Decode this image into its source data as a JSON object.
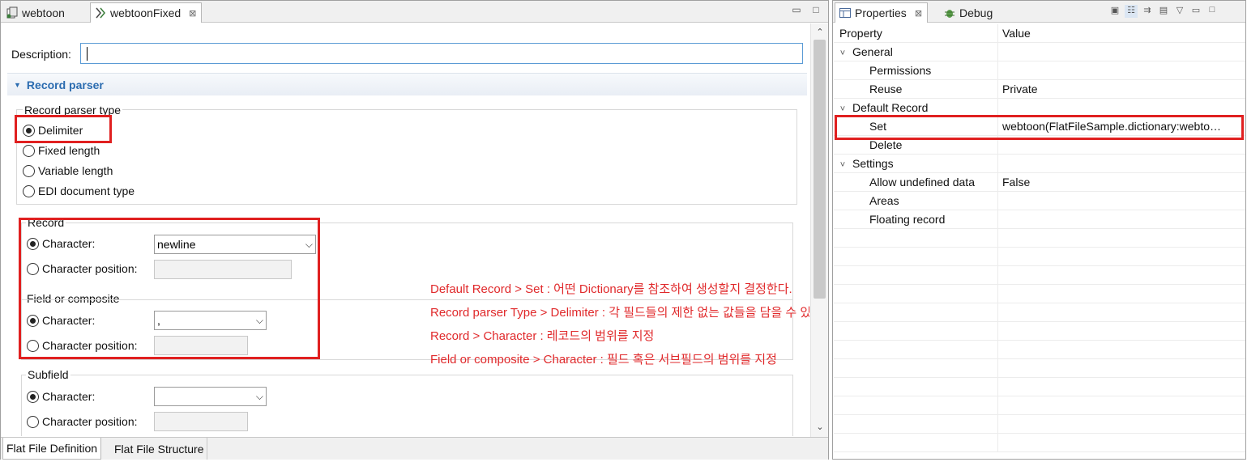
{
  "editor": {
    "tabs": [
      {
        "label": "webtoon"
      },
      {
        "label": "webtoonFixed"
      }
    ],
    "description_label": "Description:",
    "description_value": "",
    "section_title": "Record parser",
    "parser_type": {
      "title": "Record parser type",
      "options": [
        "Delimiter",
        "Fixed length",
        "Variable length",
        "EDI document type"
      ],
      "selected": "Delimiter"
    },
    "record": {
      "title": "Record",
      "character_label": "Character:",
      "character_value": "newline",
      "position_label": "Character position:"
    },
    "field": {
      "title": "Field or composite",
      "character_label": "Character:",
      "character_value": ",",
      "position_label": "Character position:"
    },
    "subfield": {
      "title": "Subfield",
      "character_label": "Character:",
      "character_value": "",
      "position_label": "Character position:"
    },
    "bottom_tabs": [
      "Flat File Definition",
      "Flat File Structure"
    ]
  },
  "notes": [
    "Default Record > Set : 어떤 Dictionary를 참조하여 생성할지 결정한다.",
    "Record parser Type > Delimiter : 각 필드들의 제한 없는 값들을 담을 수 있다.",
    "Record > Character : 레코드의 범위를 지정",
    "Field or composite > Character : 필드 혹은 서브필드의 범위를 지정"
  ],
  "properties": {
    "tabs": [
      "Properties",
      "Debug"
    ],
    "header": {
      "property": "Property",
      "value": "Value"
    },
    "rows": [
      {
        "name": "General",
        "value": "",
        "level": 0,
        "expander": "˅"
      },
      {
        "name": "Permissions",
        "value": "",
        "level": 1,
        "expander": ""
      },
      {
        "name": "Reuse",
        "value": "Private",
        "level": 1,
        "expander": ""
      },
      {
        "name": "Default Record",
        "value": "",
        "level": 0,
        "expander": "˅"
      },
      {
        "name": "Set",
        "value": "webtoon(FlatFileSample.dictionary:webto…",
        "level": 1,
        "expander": ""
      },
      {
        "name": "Delete",
        "value": "",
        "level": 1,
        "expander": ""
      },
      {
        "name": "Settings",
        "value": "",
        "level": 0,
        "expander": "˅"
      },
      {
        "name": "Allow undefined data",
        "value": "False",
        "level": 1,
        "expander": ""
      },
      {
        "name": "Areas",
        "value": "",
        "level": 1,
        "expander": ""
      },
      {
        "name": "Floating record",
        "value": "",
        "level": 1,
        "expander": ""
      }
    ]
  },
  "colors": {
    "annotation_red": "#e0292b",
    "section_blue": "#2b6cb0"
  }
}
